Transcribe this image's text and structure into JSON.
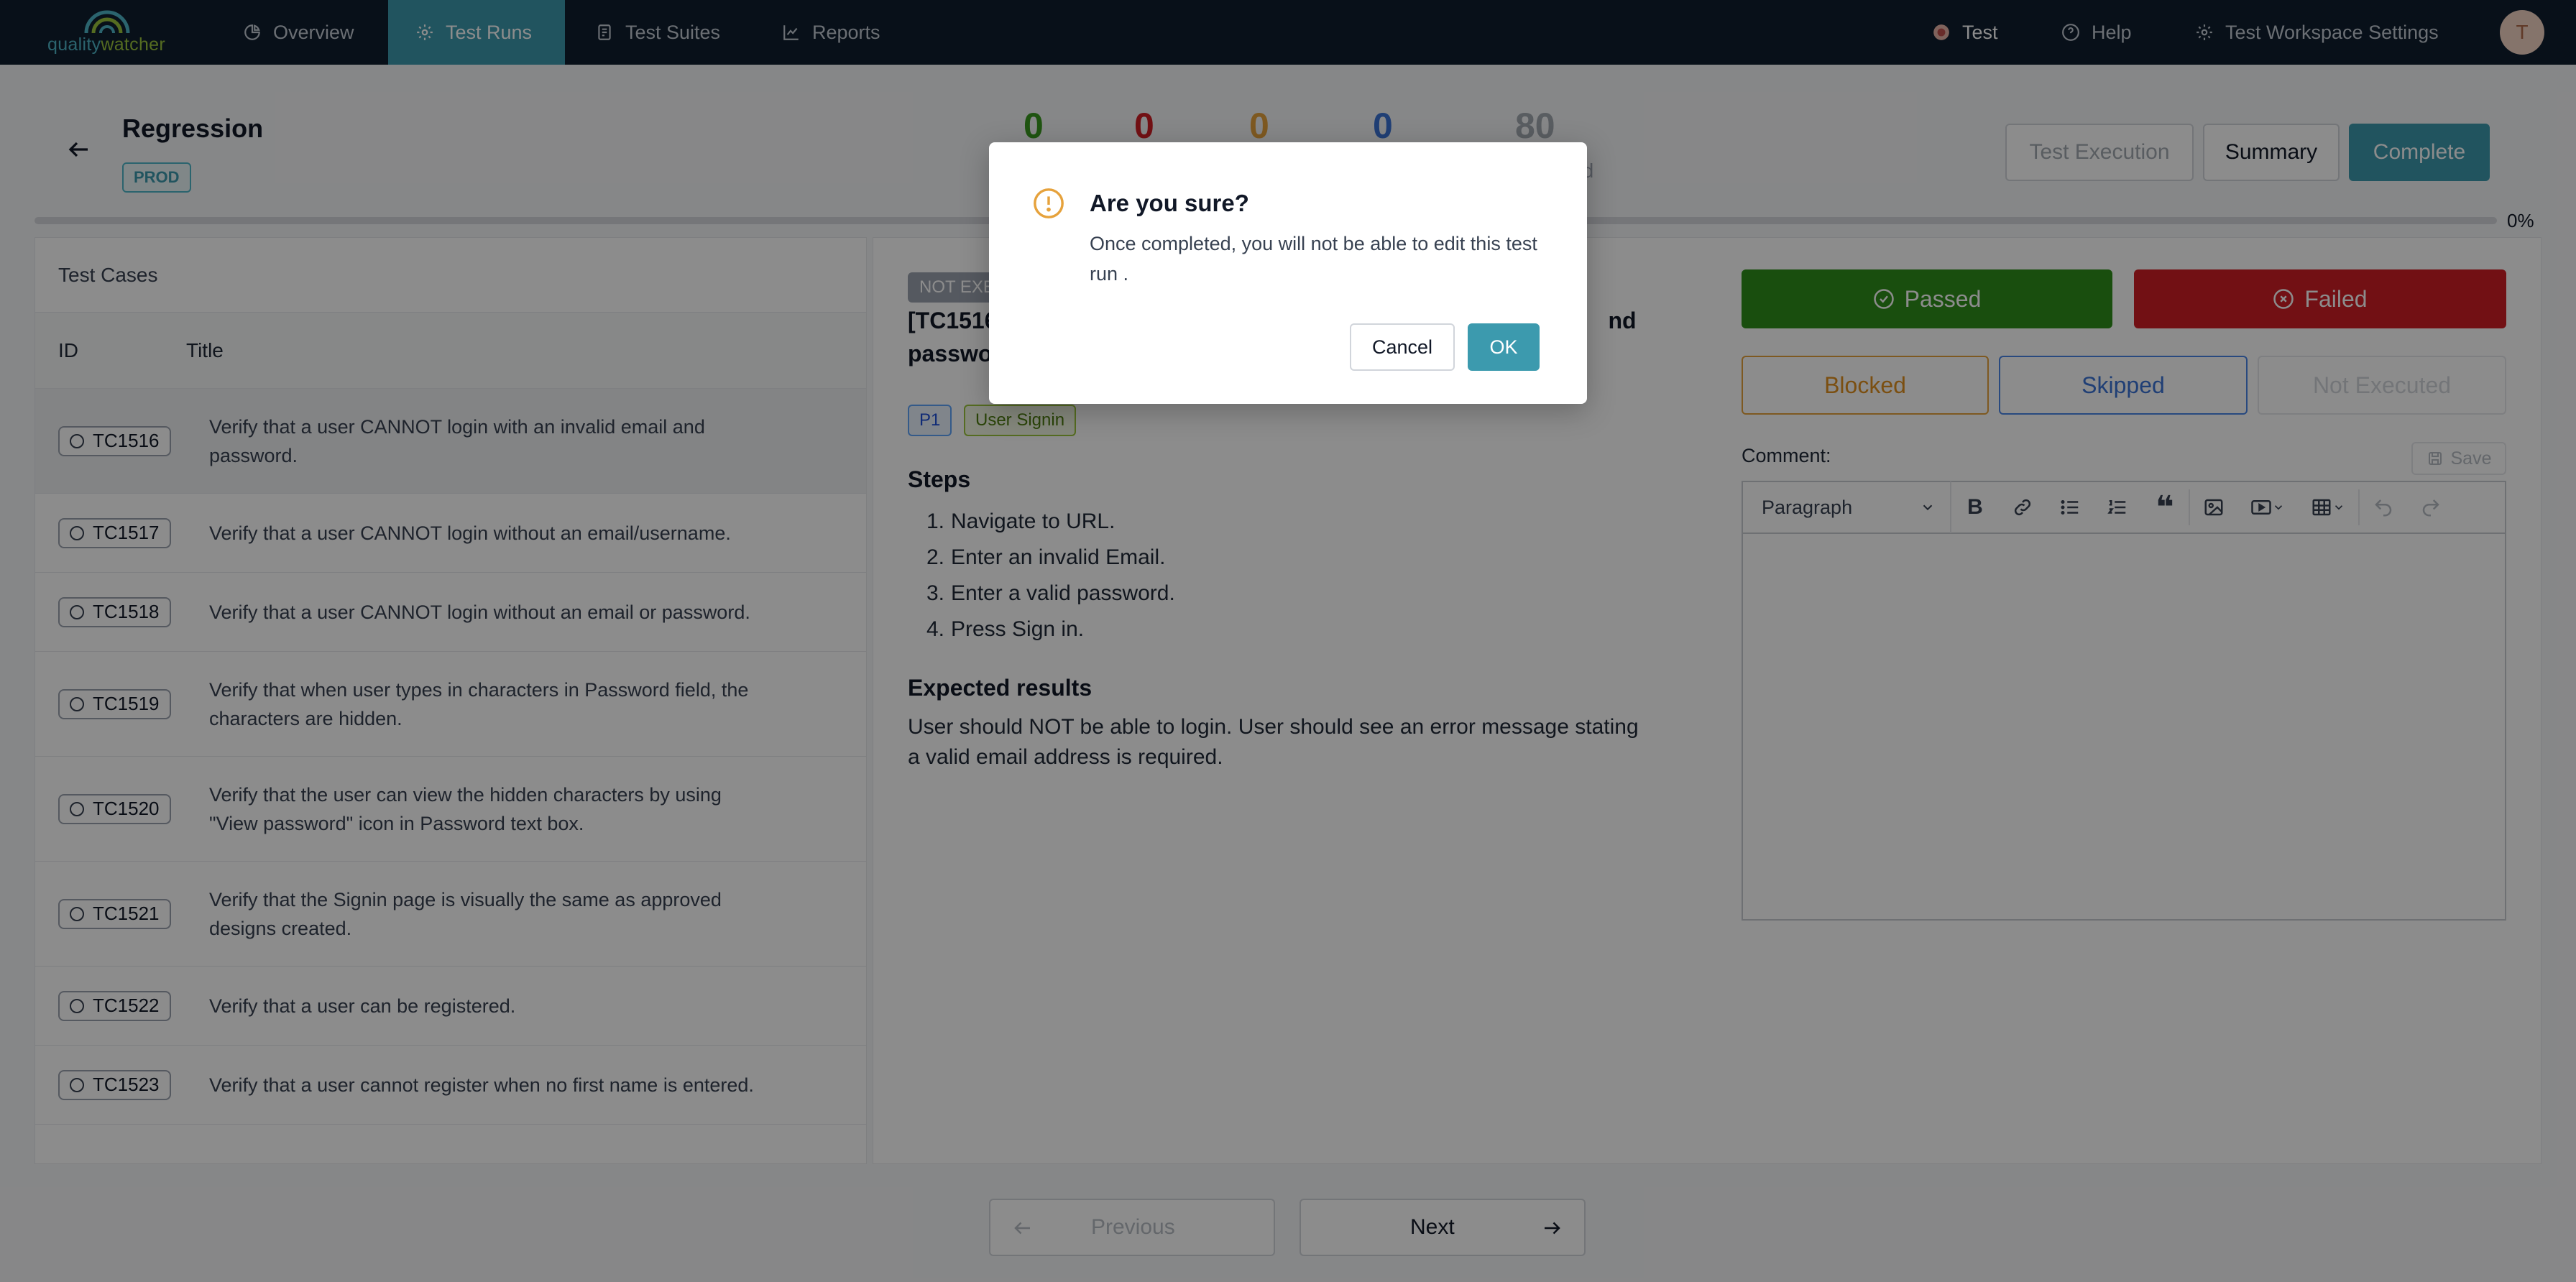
{
  "app": {
    "logo_prefix": "quality",
    "logo_suffix": "watcher",
    "avatar_initial": "T"
  },
  "nav": {
    "overview": "Overview",
    "test_runs": "Test Runs",
    "test_suites": "Test Suites",
    "reports": "Reports",
    "workspace": "Test",
    "help": "Help",
    "settings": "Test Workspace Settings"
  },
  "run": {
    "title": "Regression",
    "environment": "PROD",
    "stats": [
      {
        "value": "0",
        "color": "#3a9a1f"
      },
      {
        "value": "0",
        "color": "#cf1e26"
      },
      {
        "value": "0",
        "color": "#e6a23c"
      },
      {
        "value": "0",
        "color": "#3b73d6"
      },
      {
        "value": "80",
        "color": "#a3a9b1"
      }
    ],
    "stat_label_fragment": "ed",
    "progress_percent": "0%",
    "progress_fraction": 0
  },
  "header_buttons": {
    "execution": "Test Execution",
    "summary": "Summary",
    "complete": "Complete"
  },
  "cases": {
    "header": "Test Cases",
    "col_id": "ID",
    "col_title": "Title",
    "rows": [
      {
        "id": "TC1516",
        "title": "Verify that a user CANNOT login with an invalid email and password."
      },
      {
        "id": "TC1517",
        "title": "Verify that a user CANNOT login without an email/username."
      },
      {
        "id": "TC1518",
        "title": "Verify that a user CANNOT login without an email or password."
      },
      {
        "id": "TC1519",
        "title": "Verify that when user types in characters in Password field, the characters are hidden."
      },
      {
        "id": "TC1520",
        "title": "Verify that the user can view the hidden characters by using \"View password\" icon in Password text box."
      },
      {
        "id": "TC1521",
        "title": "Verify that the Signin page is visually the same as approved designs created."
      },
      {
        "id": "TC1522",
        "title": "Verify that a user can be registered."
      },
      {
        "id": "TC1523",
        "title": "Verify that a user cannot register when no first name is entered."
      }
    ]
  },
  "detail": {
    "status": "NOT EXE",
    "heading_start": "[TC1516",
    "heading_line2": "passwo",
    "heading_tail": "nd",
    "priority": "P1",
    "module": "User Signin",
    "steps_title": "Steps",
    "steps": [
      "Navigate to URL.",
      "Enter an invalid Email.",
      "Enter a valid password.",
      "Press Sign in."
    ],
    "expected_title": "Expected results",
    "expected": "User should NOT be able to login. User should see an error message stating a valid email address is required."
  },
  "results": {
    "passed": "Passed",
    "failed": "Failed",
    "blocked": "Blocked",
    "skipped": "Skipped",
    "not_executed": "Not Executed"
  },
  "comment": {
    "label": "Comment:",
    "save": "Save",
    "format": "Paragraph"
  },
  "pager": {
    "previous": "Previous",
    "next": "Next"
  },
  "modal": {
    "title": "Are you sure?",
    "body": "Once completed, you will not be able to edit this test run .",
    "cancel": "Cancel",
    "ok": "OK"
  }
}
